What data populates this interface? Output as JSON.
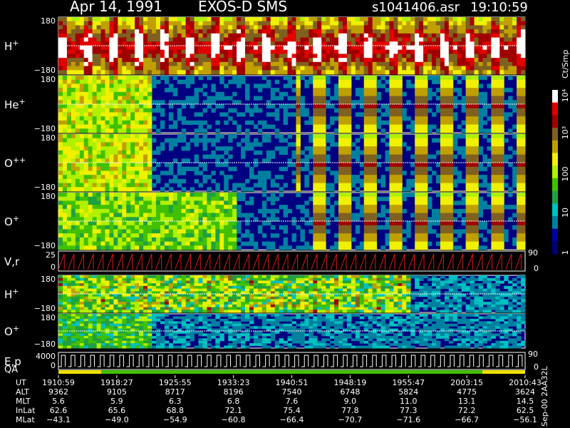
{
  "header": {
    "date": "Apr 14, 1991",
    "mission": "EXOS-D SMS",
    "file": "s1041406.asr",
    "time": "19:10:59"
  },
  "chart_data": [
    {
      "type": "heatmap",
      "label": "H",
      "label_sup": "+",
      "yticks": [
        "180",
        "−180"
      ],
      "pattern": "H+ pitch-angle spectrogram"
    },
    {
      "type": "heatmap",
      "label": "He",
      "label_sup": "+",
      "yticks": [
        "180",
        "−180"
      ]
    },
    {
      "type": "heatmap",
      "label": "O",
      "label_sup": "++",
      "yticks": [
        "180",
        "−180"
      ]
    },
    {
      "type": "heatmap",
      "label": "O",
      "label_sup": "+",
      "yticks": [
        "180",
        "−180"
      ]
    },
    {
      "type": "line",
      "label": "V,r",
      "yticks": [
        "25",
        "0"
      ],
      "right_ticks": [
        "90",
        "0"
      ],
      "color": "#e01818"
    },
    {
      "type": "heatmap",
      "label": "H",
      "label_sup": "+",
      "yticks": [
        "180",
        "−180"
      ]
    },
    {
      "type": "heatmap",
      "label": "O",
      "label_sup": "+",
      "yticks": [
        "180",
        "−180"
      ]
    },
    {
      "type": "line",
      "label": "E,p",
      "label2": "QA",
      "yticks": [
        "4000",
        "0"
      ],
      "right_ticks": [
        "90",
        "0"
      ],
      "color": "#ffffff"
    }
  ],
  "colorbar": {
    "unit_label": "Ct/Smp",
    "ticks": [
      "10⁴",
      "10³",
      "100",
      "10",
      "1"
    ],
    "colors": [
      "#ffffff",
      "#e00000",
      "#a00000",
      "#806020",
      "#c0a000",
      "#f0f000",
      "#b0f000",
      "#40c000",
      "#20a040",
      "#00c0c0",
      "#0080a0",
      "#0000a0",
      "#000070"
    ]
  },
  "time_axis": {
    "labels": [
      "UT",
      "ALT",
      "MLT",
      "InLat",
      "MLat"
    ],
    "columns": [
      {
        "UT": "1910:59",
        "ALT": "9362",
        "MLT": "5.6",
        "InLat": "62.6",
        "MLat": "−43.1"
      },
      {
        "UT": "1918:27",
        "ALT": "9105",
        "MLT": "5.9",
        "InLat": "65.6",
        "MLat": "−49.0"
      },
      {
        "UT": "1925:55",
        "ALT": "8717",
        "MLT": "6.3",
        "InLat": "68.8",
        "MLat": "−54.9"
      },
      {
        "UT": "1933:23",
        "ALT": "8196",
        "MLT": "6.8",
        "InLat": "72.1",
        "MLat": "−60.8"
      },
      {
        "UT": "1940:51",
        "ALT": "7540",
        "MLT": "7.6",
        "InLat": "75.4",
        "MLat": "−66.4"
      },
      {
        "UT": "1948:19",
        "ALT": "6748",
        "MLT": "9.0",
        "InLat": "77.8",
        "MLat": "−70.7"
      },
      {
        "UT": "1955:47",
        "ALT": "5824",
        "MLT": "11.0",
        "InLat": "77.3",
        "MLat": "−71.6"
      },
      {
        "UT": "2003:15",
        "ALT": "4775",
        "MLT": "13.1",
        "InLat": "72.2",
        "MLat": "−66.7"
      },
      {
        "UT": "2010:43",
        "ALT": "3624",
        "MLT": "14.5",
        "InLat": "62.5",
        "MLat": "−56.1"
      }
    ]
  },
  "footer_version": "Sep-00 2AA32L"
}
